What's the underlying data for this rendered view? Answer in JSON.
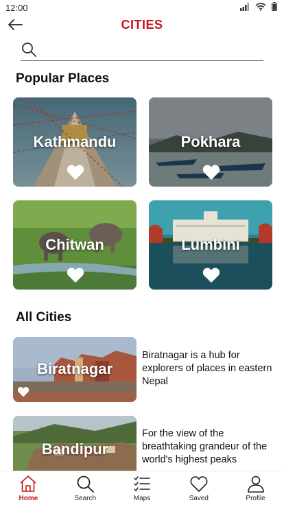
{
  "status": {
    "time": "12:00"
  },
  "header": {
    "title": "CITIES"
  },
  "search": {
    "placeholder": "",
    "value": ""
  },
  "popular": {
    "heading": "Popular Places",
    "cards": [
      {
        "name": "Kathmandu"
      },
      {
        "name": "Pokhara"
      },
      {
        "name": "Chitwan"
      },
      {
        "name": "Lumbini"
      }
    ]
  },
  "all_cities": {
    "heading": "All Cities",
    "items": [
      {
        "name": "Biratnagar",
        "description": "Biratnagar is a hub for explorers of places in eastern Nepal"
      },
      {
        "name": "Bandipur",
        "description": " For the view of the breathtaking grandeur of the world's highest peaks"
      }
    ]
  },
  "nav": {
    "items": [
      {
        "label": "Home",
        "icon": "home-icon",
        "active": true
      },
      {
        "label": "Search",
        "icon": "search-icon"
      },
      {
        "label": "Maps",
        "icon": "checklist-icon"
      },
      {
        "label": "Saved",
        "icon": "heart-icon"
      },
      {
        "label": "Profile",
        "icon": "user-icon"
      }
    ]
  },
  "colors": {
    "accent": "#c4141b",
    "text": "#111111"
  }
}
